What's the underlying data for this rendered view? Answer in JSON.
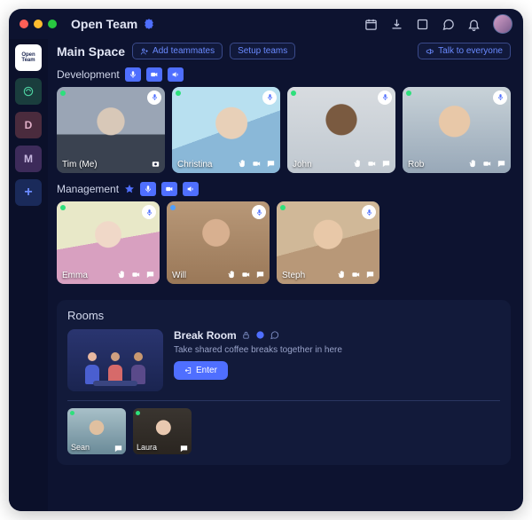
{
  "app": {
    "title": "Open Team",
    "brand_short": "Open\nTeam"
  },
  "toolbar": {
    "icons": [
      "calendar",
      "download",
      "window",
      "chat",
      "bell"
    ]
  },
  "sidebar": {
    "items": [
      {
        "id": "logo",
        "label": "Open Team"
      },
      {
        "id": "g",
        "label": ""
      },
      {
        "id": "d",
        "label": "D"
      },
      {
        "id": "m",
        "label": "M"
      },
      {
        "id": "add",
        "label": "+"
      }
    ]
  },
  "space": {
    "title": "Main Space",
    "add_teammates": "Add teammates",
    "setup_teams": "Setup teams",
    "talk_everyone": "Talk to everyone"
  },
  "sections": {
    "development": {
      "title": "Development",
      "people": [
        {
          "name": "Tim (Me)",
          "status": "green",
          "photo": "ph1",
          "self": true
        },
        {
          "name": "Christina",
          "status": "green",
          "photo": "ph2"
        },
        {
          "name": "John",
          "status": "green",
          "photo": "ph3"
        },
        {
          "name": "Rob",
          "status": "green",
          "photo": "ph4"
        }
      ]
    },
    "management": {
      "title": "Management",
      "starred": true,
      "people": [
        {
          "name": "Emma",
          "status": "green",
          "photo": "ph5"
        },
        {
          "name": "Will",
          "status": "blue",
          "photo": "ph6"
        },
        {
          "name": "Steph",
          "status": "green",
          "photo": "ph7"
        }
      ]
    }
  },
  "rooms": {
    "title": "Rooms",
    "break_room": {
      "name": "Break Room",
      "desc": "Take shared coffee breaks together in here",
      "enter": "Enter",
      "people": [
        {
          "name": "Sean",
          "status": "green",
          "photo": "ph8"
        },
        {
          "name": "Laura",
          "status": "green",
          "photo": "ph9"
        }
      ]
    }
  },
  "colors": {
    "bg": "#0d1330",
    "panel": "#121a3a",
    "accent": "#4f6fff",
    "success": "#2ee07c"
  }
}
